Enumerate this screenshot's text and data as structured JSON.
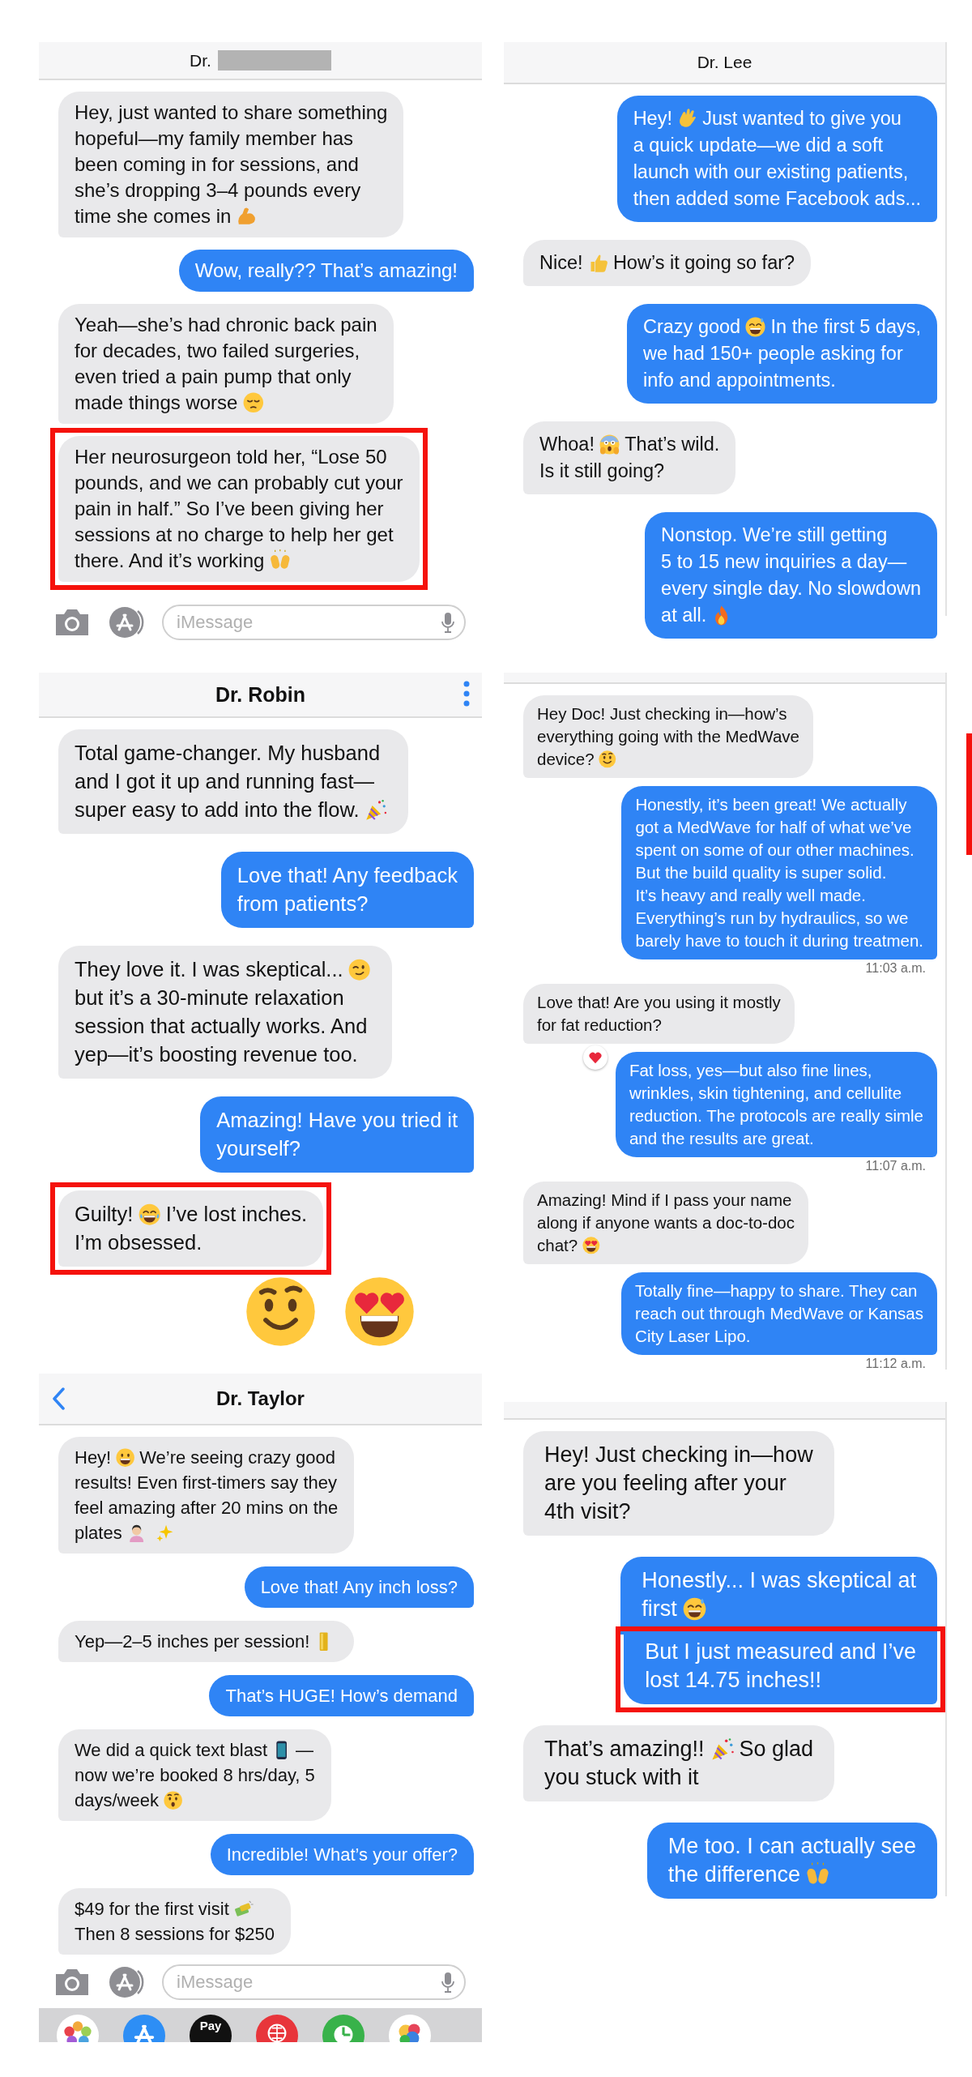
{
  "panels": [
    {
      "header": {
        "title": "Dr.",
        "redacted": true
      },
      "messages": [
        {
          "sent": false,
          "lines": [
            [
              "Hey, just wanted to share something"
            ],
            [
              "hopeful—my family member has"
            ],
            [
              "been coming in for sessions, and"
            ],
            [
              "she’s dropping 3–4 pounds every"
            ],
            [
              "time she comes in",
              {
                "kind": "muscle"
              }
            ]
          ]
        },
        {
          "sent": true,
          "lines": [
            [
              "Wow, really?? That’s amazing!"
            ]
          ]
        },
        {
          "sent": false,
          "lines": [
            [
              "Yeah—she’s had chronic back pain"
            ],
            [
              "for decades, two failed surgeries,"
            ],
            [
              "even tried a pain pump that only"
            ],
            [
              "made things worse",
              {
                "kind": "pensive"
              }
            ]
          ]
        },
        {
          "sent": false,
          "highlighted": true,
          "lines": [
            [
              "Her neurosurgeon told her, “Lose 50"
            ],
            [
              "pounds, and we can probably cut your"
            ],
            [
              "pain in half.” So I’ve been giving her"
            ],
            [
              "sessions at no charge to help her get"
            ],
            [
              "there. And it’s working",
              {
                "kind": "hands"
              }
            ]
          ]
        }
      ],
      "composer": {
        "placeholder": "iMessage"
      }
    },
    {
      "header": {
        "title": "Dr. Lee"
      },
      "messages": [
        {
          "sent": true,
          "lines": [
            [
              "Hey!",
              {
                "kind": "wave"
              },
              "Just wanted to give you"
            ],
            [
              "a quick update—we did a soft"
            ],
            [
              "launch with our existing patients,"
            ],
            [
              "then added some Facebook ads..."
            ]
          ]
        },
        {
          "sent": false,
          "lines": [
            [
              "Nice!",
              {
                "kind": "thumbsup"
              },
              "How’s it going so far?"
            ]
          ]
        },
        {
          "sent": true,
          "lines": [
            [
              "Crazy good",
              {
                "kind": "sweatgrin"
              },
              "In the first 5 days,"
            ],
            [
              "we had 150+ people asking for"
            ],
            [
              "info and appointments."
            ]
          ]
        },
        {
          "sent": false,
          "lines": [
            [
              "Whoa!",
              {
                "kind": "scream"
              },
              "That’s wild."
            ],
            [
              "Is it still going?"
            ]
          ]
        },
        {
          "sent": true,
          "lines": [
            [
              "Nonstop. We’re still getting"
            ],
            [
              "5 to 15 new inquiries a day—"
            ],
            [
              "every single day. No slowdown"
            ],
            [
              "at all.",
              {
                "kind": "fire"
              }
            ]
          ]
        }
      ]
    },
    {
      "header": {
        "title": "Dr. Robin",
        "menu": true
      },
      "messages": [
        {
          "sent": false,
          "lines": [
            [
              "Total game-changer. My husband"
            ],
            [
              "and I got it up and running fast—"
            ],
            [
              "super easy to add into the flow.",
              {
                "kind": "party"
              }
            ]
          ]
        },
        {
          "sent": true,
          "lines": [
            [
              "Love that! Any feedback"
            ],
            [
              "from patients?"
            ]
          ]
        },
        {
          "sent": false,
          "lines": [
            [
              "They love it. I was skeptical...",
              {
                "kind": "smirk"
              }
            ],
            [
              "but it’s a 30-minute relaxation"
            ],
            [
              "session that actually works. And"
            ],
            [
              "yep—it’s boosting revenue too."
            ]
          ]
        },
        {
          "sent": true,
          "lines": [
            [
              "Amazing! Have you tried it"
            ],
            [
              "yourself?"
            ]
          ]
        },
        {
          "sent": false,
          "highlighted": true,
          "lines": [
            [
              "Guilty!",
              {
                "kind": "laugh"
              },
              "I’ve lost inches."
            ],
            [
              "I’m obsessed."
            ]
          ]
        }
      ],
      "large_emojis": [
        {
          "kind": "smile"
        },
        {
          "kind": "hearteyes"
        }
      ]
    },
    {
      "messages": [
        {
          "sent": false,
          "lines": [
            [
              "Hey Doc! Just checking in—how’s"
            ],
            [
              "everything going with the MedWave"
            ],
            [
              "device?",
              {
                "kind": "smile"
              }
            ]
          ]
        },
        {
          "sent": true,
          "time": "11:03 a.m.",
          "lines": [
            [
              "Honestly, it’s been great! We actually"
            ],
            [
              "got a MedWave for half of what we’ve"
            ],
            [
              "spent on some of our other machines."
            ],
            [
              "But the build quality is super solid."
            ],
            [
              "It’s heavy and really well made."
            ],
            [
              "Everything’s run by hydraulics, so we"
            ],
            [
              "barely have to touch it during treatmen."
            ]
          ]
        },
        {
          "sent": false,
          "lines": [
            [
              "Love that! Are you using it mostly"
            ],
            [
              "for fat reduction?"
            ]
          ]
        },
        {
          "sent": true,
          "reacted": true,
          "time": "11:07 a.m.",
          "lines": [
            [
              "Fat loss, yes—but also fine lines,"
            ],
            [
              "wrinkles, skin tightening, and cellulite"
            ],
            [
              "reduction. The protocols are really simle"
            ],
            [
              "and the results are great."
            ]
          ]
        },
        {
          "sent": false,
          "lines": [
            [
              "Amazing! Mind if I pass your name"
            ],
            [
              "along if anyone wants a doc-to-doc"
            ],
            [
              "chat?",
              {
                "kind": "hearteyes"
              }
            ]
          ]
        },
        {
          "sent": true,
          "time": "11:12 a.m.",
          "lines": [
            [
              "Totally fine—happy to share. They can"
            ],
            [
              "reach out through MedWave or Kansas"
            ],
            [
              "City Laser Lipo."
            ]
          ]
        }
      ]
    },
    {
      "header": {
        "title": "Dr. Taylor",
        "back": true
      },
      "messages": [
        {
          "sent": false,
          "lines": [
            [
              "Hey!",
              {
                "kind": "grin"
              },
              "We’re seeing crazy good"
            ],
            [
              "results! Even first-timers say they"
            ],
            [
              "feel amazing after 20 mins on the"
            ],
            [
              "plates",
              {
                "kind": "person"
              },
              {
                "kind": "sparkles"
              }
            ]
          ]
        },
        {
          "sent": true,
          "lines": [
            [
              "Love that! Any inch loss?"
            ]
          ]
        },
        {
          "sent": false,
          "lines": [
            [
              "Yep—2–5 inches per session!",
              {
                "kind": "bar"
              }
            ]
          ]
        },
        {
          "sent": true,
          "lines": [
            [
              "That’s HUGE! How’s demand"
            ]
          ]
        },
        {
          "sent": false,
          "lines": [
            [
              "We did a quick text blast",
              {
                "kind": "phone"
              },
              "—"
            ],
            [
              "now we’re booked 8 hrs/day, 5"
            ],
            [
              "days/week",
              {
                "kind": "hushed"
              }
            ]
          ]
        },
        {
          "sent": true,
          "lines": [
            [
              "Incredible! What’s your offer?"
            ]
          ]
        },
        {
          "sent": false,
          "lines": [
            [
              "$49 for the first visit",
              {
                "kind": "money"
              }
            ],
            [
              "Then 8 sessions for $250"
            ]
          ]
        }
      ],
      "composer": {
        "placeholder": "iMessage"
      },
      "dock": [
        {
          "kind": "photos"
        },
        {
          "kind": "appstore"
        },
        {
          "kind": "pay",
          "label": "Pay"
        },
        {
          "kind": "globe"
        },
        {
          "kind": "clock"
        },
        {
          "kind": "game"
        }
      ]
    },
    {
      "messages": [
        {
          "sent": false,
          "lines": [
            [
              "Hey! Just checking in—how"
            ],
            [
              "are you feeling after your"
            ],
            [
              "4th visit?"
            ]
          ]
        },
        {
          "sent": true,
          "continues": true,
          "lines": [
            [
              "Honestly... I was skeptical at"
            ],
            [
              "first",
              {
                "kind": "sweatgrin"
              }
            ]
          ]
        },
        {
          "sent": true,
          "highlighted": true,
          "lines": [
            [
              "But I just measured and I’ve"
            ],
            [
              "lost 14.75 inches!!"
            ]
          ]
        },
        {
          "sent": false,
          "lines": [
            [
              "That’s amazing!!",
              {
                "kind": "party"
              },
              "So glad"
            ],
            [
              "you stuck with it"
            ]
          ]
        },
        {
          "sent": true,
          "lines": [
            [
              "Me too. I can actually see"
            ],
            [
              "the difference",
              {
                "kind": "hands"
              }
            ]
          ]
        }
      ]
    }
  ]
}
